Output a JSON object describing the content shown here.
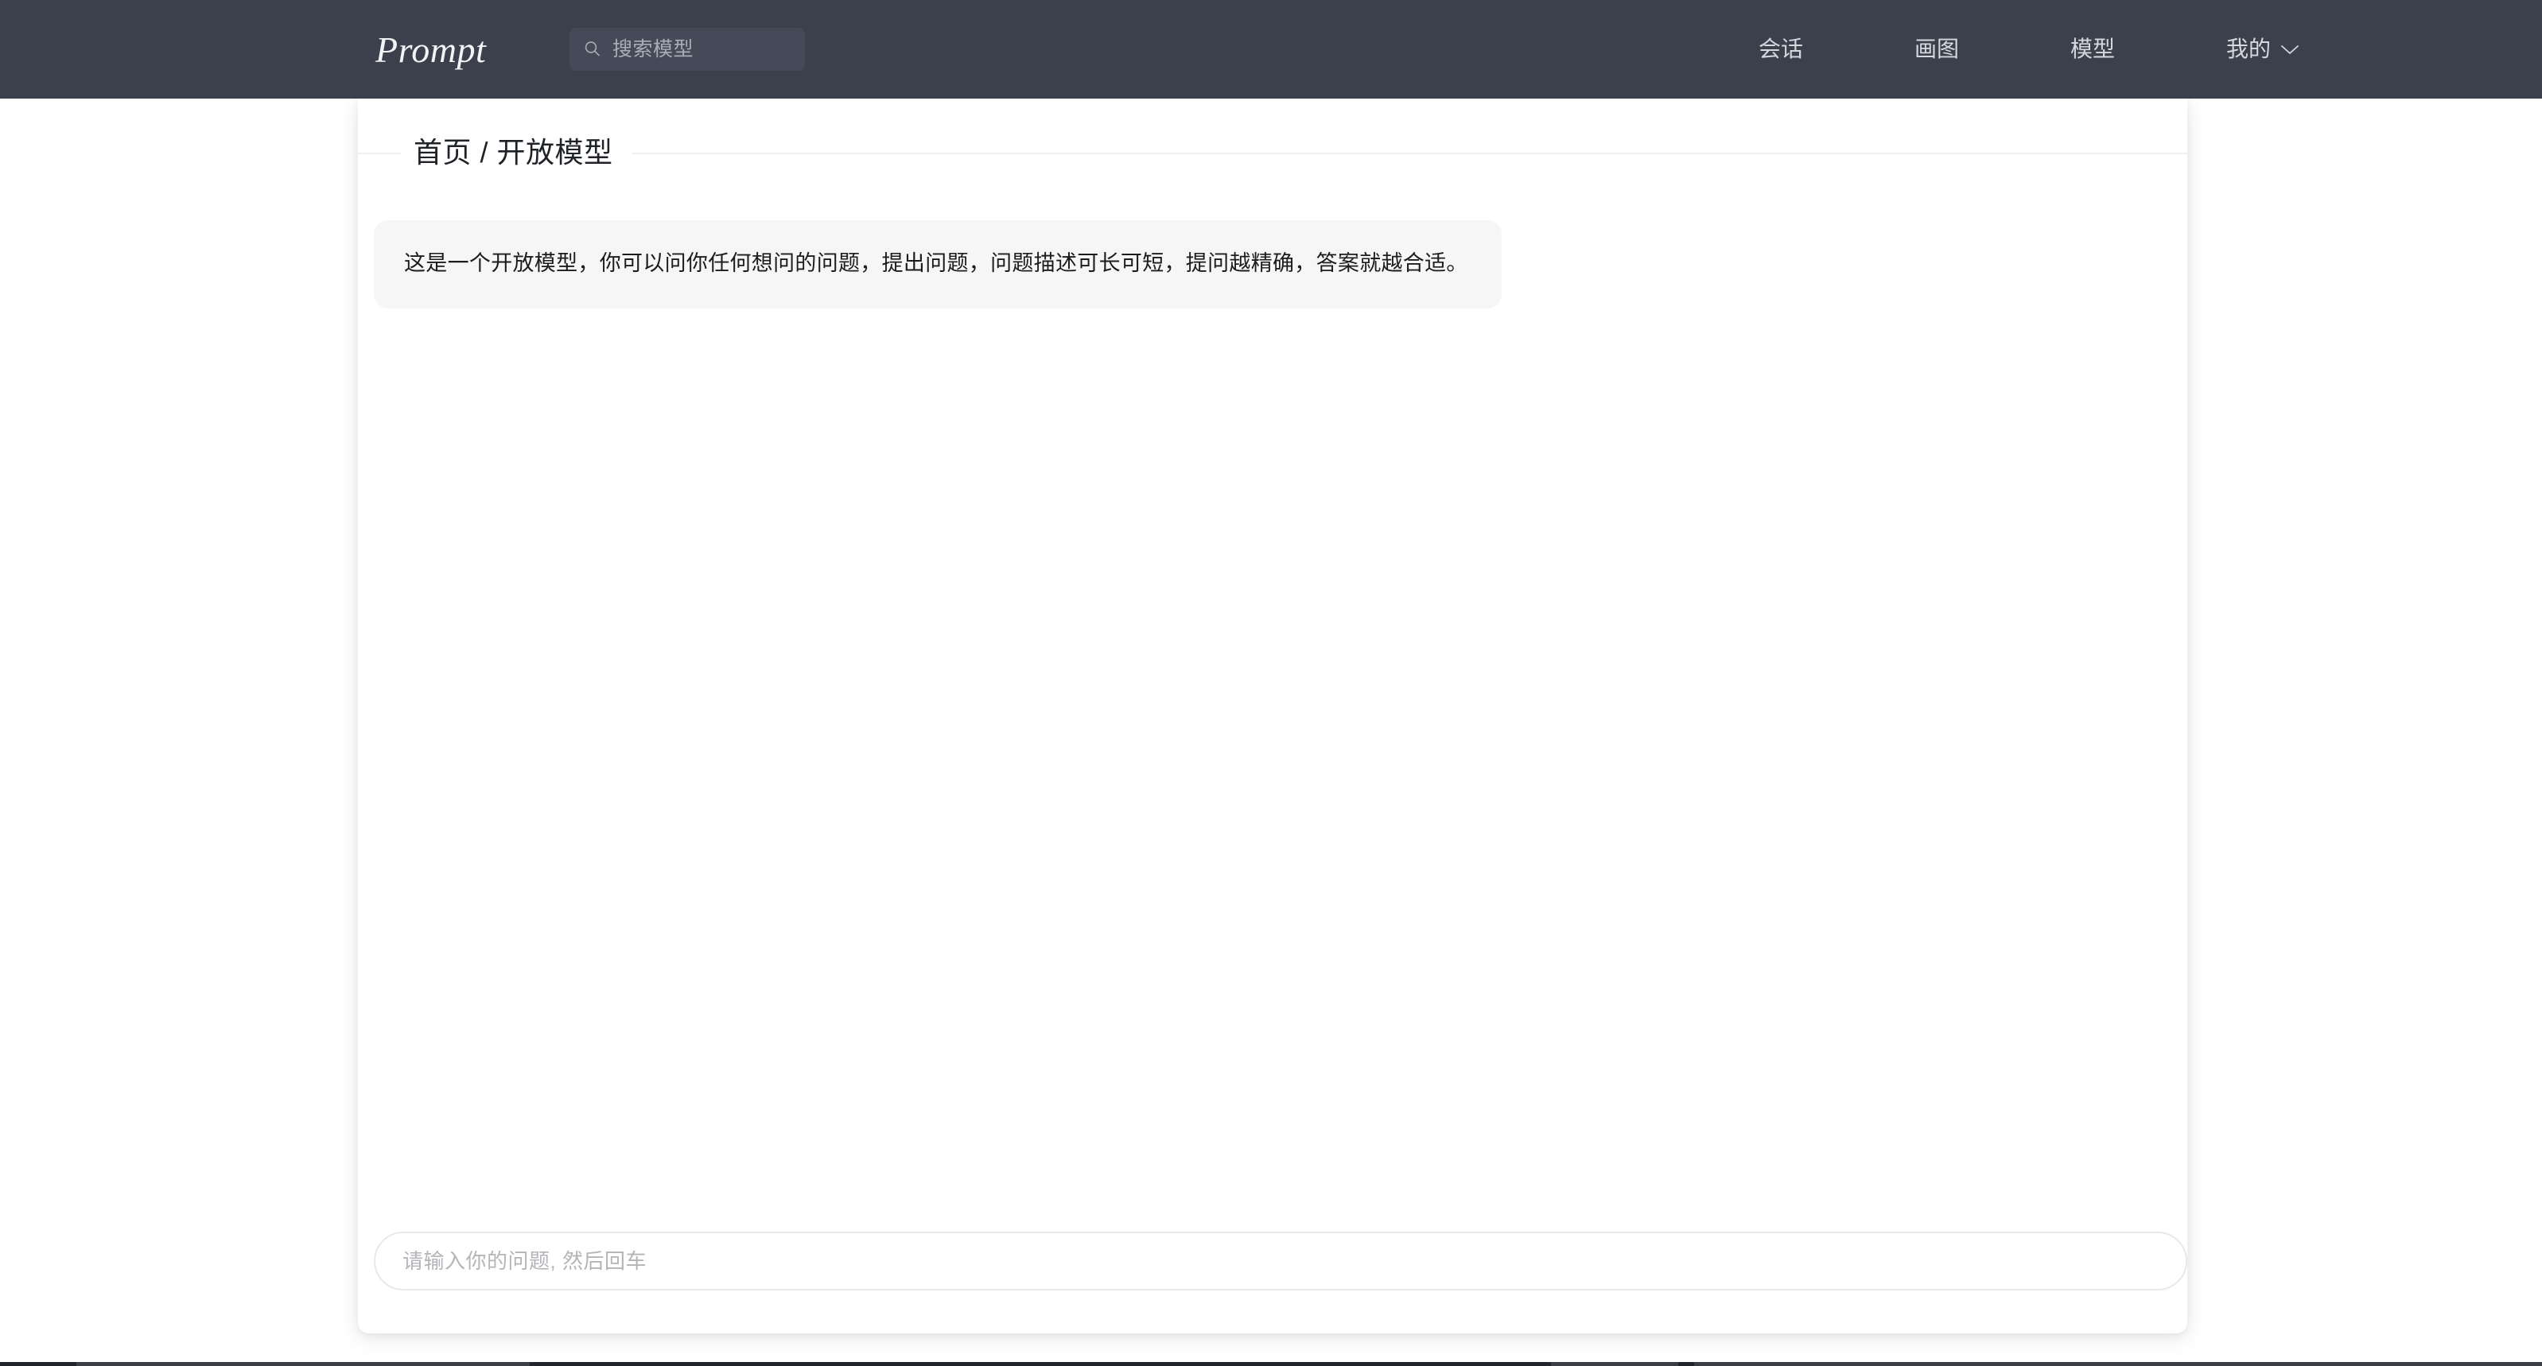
{
  "navbar": {
    "brand": "Prompt",
    "brand_color": "#f2f3f5",
    "background_color": "#3b404c",
    "search": {
      "icon": "search-icon",
      "placeholder": "搜索模型",
      "value": ""
    },
    "links": [
      {
        "label": "会话",
        "icon": null
      },
      {
        "label": "画图",
        "icon": null
      },
      {
        "label": "模型",
        "icon": null
      },
      {
        "label": "我的",
        "icon": "chevron-down-icon"
      }
    ]
  },
  "card": {
    "breadcrumb": "首页 / 开放模型",
    "breadcrumb_parts": [
      "首页",
      "开放模型"
    ],
    "separator": "/"
  },
  "chat": {
    "messages": [
      {
        "role": "assistant",
        "text": "这是一个开放模型，你可以问你任何想问的问题，提出问题，问题描述可长可短，提问越精确，答案就越合适。",
        "bubble_color": "#f6f6f7"
      }
    ]
  },
  "composer": {
    "placeholder": "请输入你的问题, 然后回车",
    "value": ""
  },
  "colors": {
    "nav_background": "#3b404c",
    "search_background": "#444a57",
    "page_background": "#ffffff",
    "card_background": "#ffffff",
    "bubble_background": "#f6f6f7",
    "divider": "#efefef",
    "input_border": "#e7e8ea",
    "text_primary": "#1c1c1e",
    "text_muted": "#b3b5b9",
    "nav_text": "#d5d8de"
  }
}
